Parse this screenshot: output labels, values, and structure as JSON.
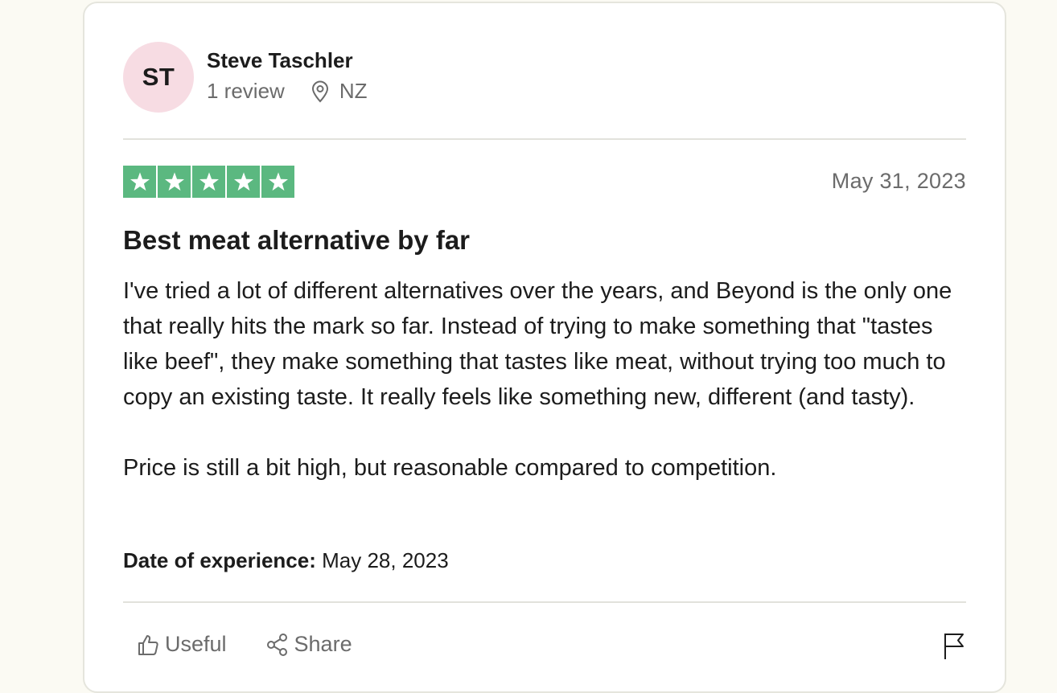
{
  "consumer": {
    "initials": "ST",
    "name": "Steve Taschler",
    "review_count": "1 review",
    "location": "NZ"
  },
  "review": {
    "rating": 5,
    "rating_max": 5,
    "star_color": "#5bb880",
    "date": "May 31, 2023",
    "title": "Best meat alternative by far",
    "body_paragraph_1": "I've tried a lot of different alternatives over the years, and Beyond is the only one that really hits the mark so far. Instead of trying to make something that \"tastes like beef\", they make something that tastes like meat, without trying too much to copy an existing taste. It really feels like something new, different (and tasty).",
    "body_paragraph_2": "Price is still a bit high, but reasonable compared to competition.",
    "experience_label": "Date of experience:",
    "experience_date": "May 28, 2023"
  },
  "actions": {
    "useful_label": "Useful",
    "share_label": "Share",
    "useful_icon": "thumbs-up-icon",
    "share_icon": "share-icon",
    "report_icon": "flag-icon"
  },
  "colors": {
    "avatar_bg": "#f7dce3",
    "page_bg": "#fbfaf3",
    "muted_text": "#6b6b6b"
  }
}
